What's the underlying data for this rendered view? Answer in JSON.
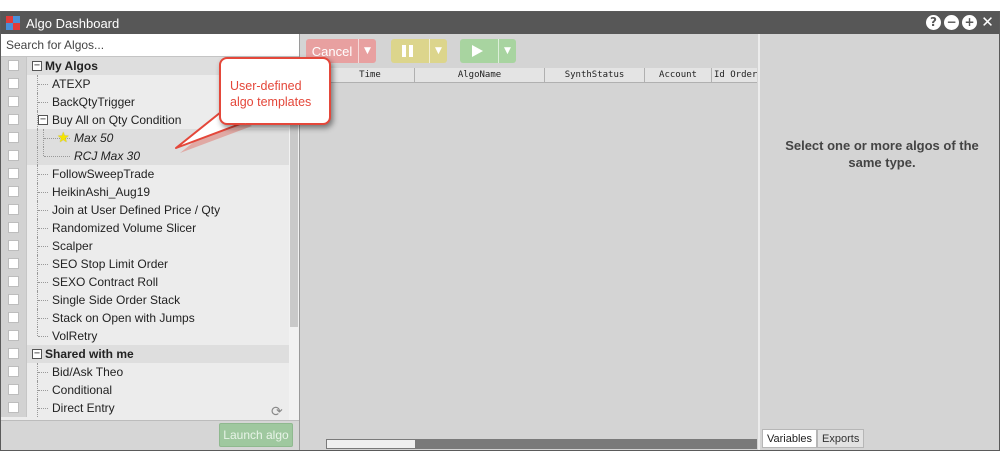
{
  "window": {
    "title": "Algo Dashboard"
  },
  "title_controls": [
    "?",
    "−",
    "+",
    "✕"
  ],
  "search": {
    "placeholder": "Search for Algos..."
  },
  "tree": {
    "my_algos": {
      "label": "My Algos",
      "items": [
        "ATEXP",
        "BackQtyTrigger"
      ],
      "group": {
        "label": "Buy All on Qty Condition",
        "templates": [
          "Max 50",
          "RCJ Max 30"
        ]
      },
      "items_after": [
        "FollowSweepTrade",
        "HeikinAshi_Aug19",
        "Join at User Defined Price / Qty",
        "Randomized Volume Slicer",
        "Scalper",
        "SEO Stop Limit Order",
        "SEXO Contract Roll",
        "Single Side Order Stack",
        "Stack on Open with Jumps",
        "VolRetry"
      ]
    },
    "shared": {
      "label": "Shared with me",
      "items": [
        "Bid/Ask Theo",
        "Conditional",
        "Direct Entry"
      ]
    }
  },
  "launch_button": "Launch algo",
  "toolbar": {
    "cancel_label": "Cancel"
  },
  "grid": {
    "columns": [
      "",
      "Time",
      "AlgoName",
      "SynthStatus",
      "Account",
      "Id Order"
    ]
  },
  "right_panel": {
    "message": "Select one or more algos of the same type."
  },
  "tabs": [
    "Variables",
    "Exports"
  ],
  "callout": {
    "text": "User-defined algo templates"
  },
  "colors": {
    "titlebar": "#575757",
    "callout": "#e4473a",
    "cancel": "#e8a0a0",
    "pause": "#dcd58c",
    "play": "#a8d4a0",
    "launch": "#9fc89f"
  }
}
